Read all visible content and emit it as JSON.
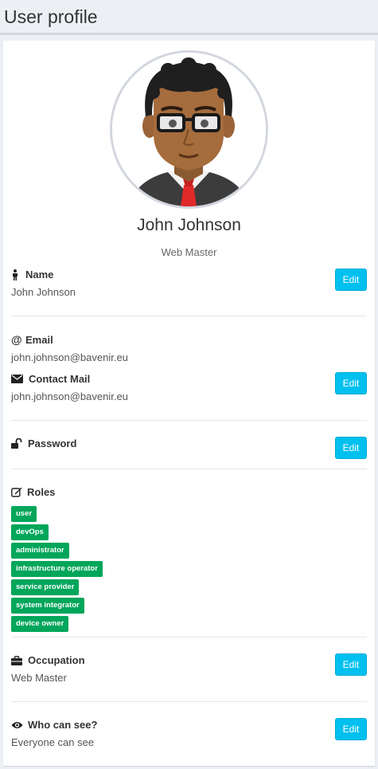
{
  "page": {
    "title": "User profile"
  },
  "profile": {
    "full_name": "John Johnson",
    "occupation_subtitle": "Web Master"
  },
  "fields": {
    "name": {
      "label": "Name",
      "value": "John Johnson",
      "icon": "person-icon"
    },
    "email": {
      "label": "Email",
      "value": "john.johnson@bavenir.eu",
      "icon": "at-icon"
    },
    "contact": {
      "label": "Contact Mail",
      "value": "john.johnson@bavenir.eu",
      "icon": "envelope-icon"
    },
    "password": {
      "label": "Password",
      "icon": "unlock-icon"
    },
    "roles": {
      "label": "Roles",
      "icon": "edit-icon",
      "items": [
        "user",
        "devOps",
        "administrator",
        "infrastructure operator",
        "service provider",
        "system integrator",
        "device owner"
      ]
    },
    "occupation": {
      "label": "Occupation",
      "value": "Web Master",
      "icon": "briefcase-icon"
    },
    "visibility": {
      "label": "Who can see?",
      "value": "Everyone can see",
      "icon": "eye-icon"
    }
  },
  "buttons": {
    "edit_label": "Edit"
  },
  "colors": {
    "edit_button": "#00c0ef",
    "role_tag": "#00a65a"
  }
}
